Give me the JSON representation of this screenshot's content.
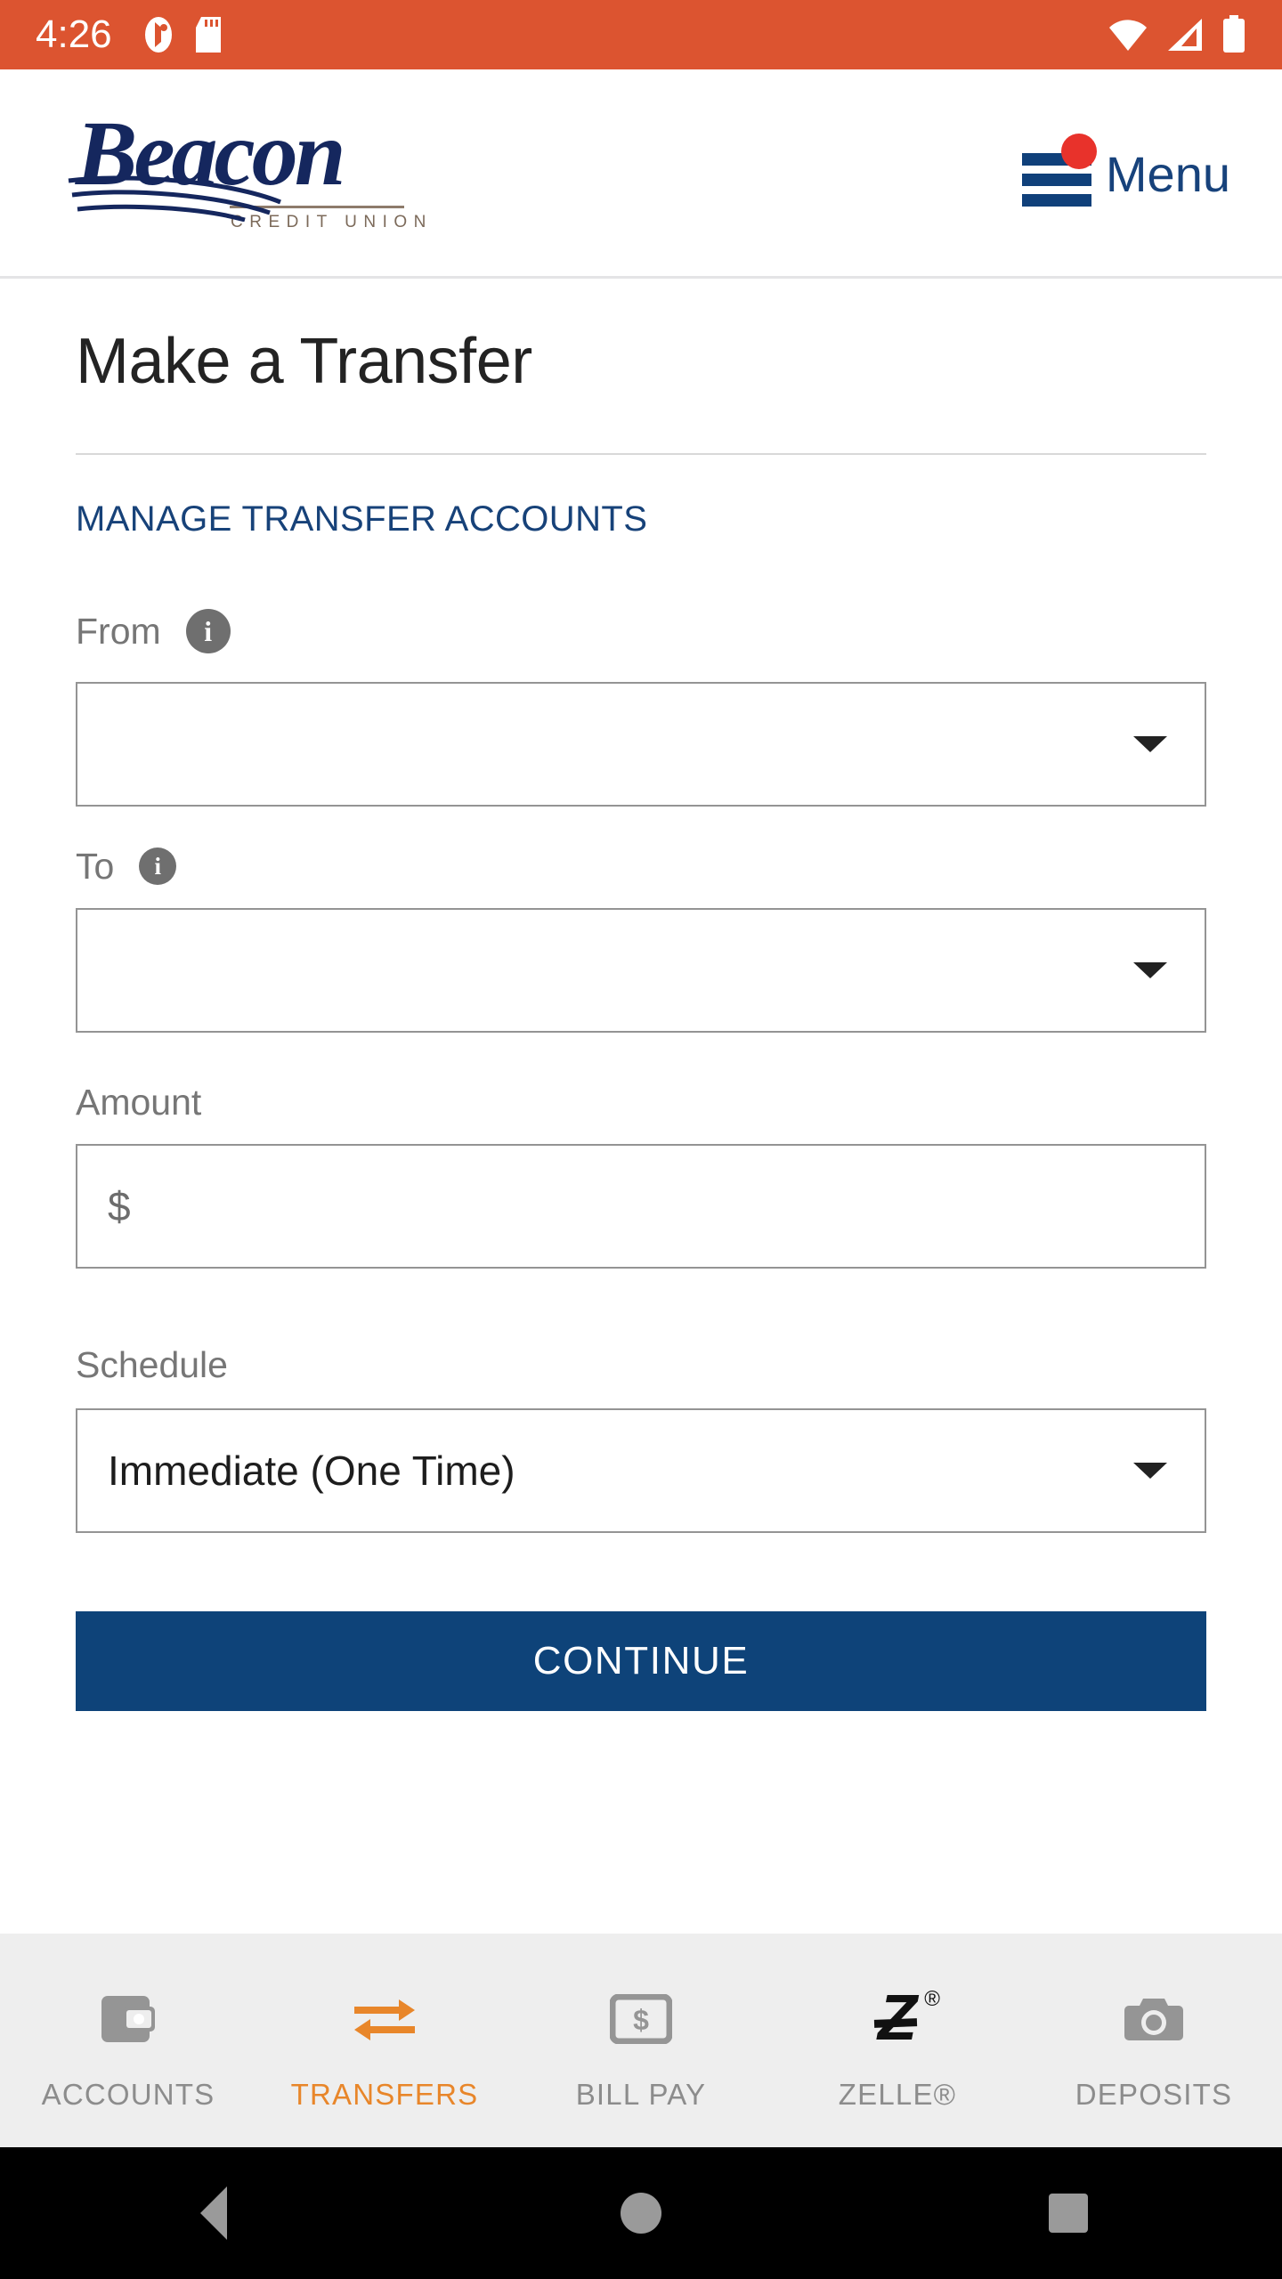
{
  "status_bar": {
    "time": "4:26",
    "background_color": "#DC5430",
    "left_icons": [
      "heart-monitor-icon",
      "sd-card-icon"
    ],
    "right_icons": [
      "wifi-icon",
      "cell-signal-icon",
      "battery-full-icon"
    ]
  },
  "header": {
    "logo": {
      "name": "Beacon",
      "subtitle": "CREDIT UNION",
      "brand_color": "#15275E",
      "subtitle_color": "#7C6A5A"
    },
    "menu": {
      "label": "Menu",
      "has_notification_dot": true,
      "dot_color": "#E8322B",
      "color": "#17427B"
    }
  },
  "main": {
    "page_title": "Make a Transfer",
    "manage_link": "MANAGE TRANSFER ACCOUNTS",
    "link_color": "#174279",
    "fields": {
      "from": {
        "label": "From",
        "info_icon": "info-icon",
        "value": "",
        "placeholder": ""
      },
      "to": {
        "label": "To",
        "info_icon": "info-icon",
        "value": "",
        "placeholder": ""
      },
      "amount": {
        "label": "Amount",
        "value": "",
        "placeholder": "$"
      },
      "schedule": {
        "label": "Schedule",
        "value": "Immediate (One Time)",
        "options": [
          "Immediate (One Time)"
        ]
      }
    },
    "continue_button": {
      "label": "CONTINUE",
      "background_color": "#0E4379",
      "text_color": "#FFFFFF"
    }
  },
  "tab_bar": {
    "active_color": "#E8862A",
    "inactive_color": "#8C8C8C",
    "background_color": "#EEEEEE",
    "items": [
      {
        "label": "ACCOUNTS",
        "icon": "wallet-icon",
        "active": false
      },
      {
        "label": "TRANSFERS",
        "icon": "exchange-arrows-icon",
        "active": true
      },
      {
        "label": "BILL PAY",
        "icon": "money-bill-icon",
        "active": false
      },
      {
        "label": "ZELLE®",
        "icon": "zelle-icon",
        "active": false
      },
      {
        "label": "DEPOSITS",
        "icon": "camera-icon",
        "active": false
      }
    ]
  },
  "nav_bar": {
    "buttons": [
      "back-button",
      "home-button",
      "recents-button"
    ],
    "background_color": "#000000",
    "icon_color": "#9A9A9A"
  }
}
